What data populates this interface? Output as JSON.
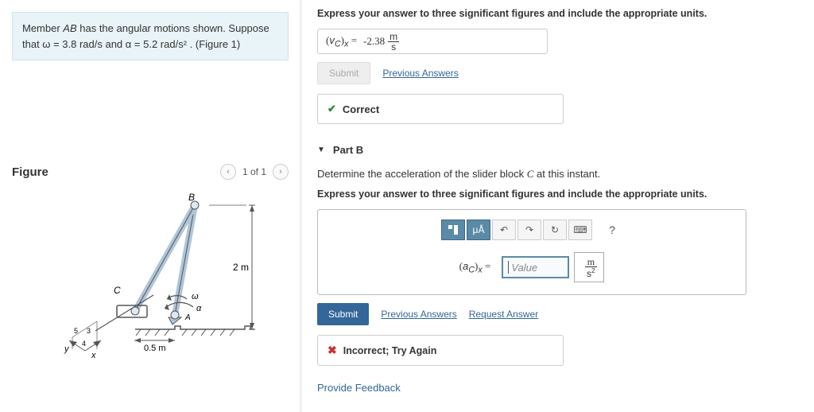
{
  "left": {
    "question_pre": "Member ",
    "var_AB": "AB",
    "question_mid1": " has the angular motions shown. Suppose that ",
    "omega_text": "ω = 3.8 rad/s",
    "and_text": " and ",
    "alpha_text": "α = 5.2 rad/s²",
    "suffix": " . (Figure 1)",
    "figure_label": "Figure",
    "nav_prev": "‹",
    "nav_text": "1 of 1",
    "nav_next": "›",
    "dim_2m": "2 m",
    "dim_05m": "0.5 m",
    "lbl_B": "B",
    "lbl_C": "C",
    "lbl_A": "A",
    "lbl_omega": "ω",
    "lbl_alpha": "α",
    "lbl_y": "y",
    "lbl_x": "x",
    "ang3": "3",
    "ang4": "4",
    "ang5": "5"
  },
  "right": {
    "instr1": "Express your answer to three significant figures and include the appropriate units.",
    "partA_expr": "(v_C)_x =",
    "partA_val": "-2.38",
    "unit_top_m": "m",
    "unit_bot_s": "s",
    "submit_label": "Submit",
    "prev_answers": "Previous Answers",
    "correct": "Correct",
    "partB_label": "Part B",
    "partB_q_pre": "Determine the acceleration of the slider block ",
    "partB_q_C": "C",
    "partB_q_post": " at this instant.",
    "instr2": "Express your answer to three significant figures and include the appropriate units.",
    "tb_mu": "μÅ",
    "tb_undo": "↶",
    "tb_redo": "↷",
    "tb_reset": "↻",
    "tb_kbd": "⌨",
    "tb_help": "?",
    "partB_expr": "(a_C)_x =",
    "value_ph": "Value",
    "unitB_top": "m",
    "unitB_bot": "s²",
    "req_answer": "Request Answer",
    "incorrect": "Incorrect; Try Again",
    "feedback": "Provide Feedback"
  }
}
